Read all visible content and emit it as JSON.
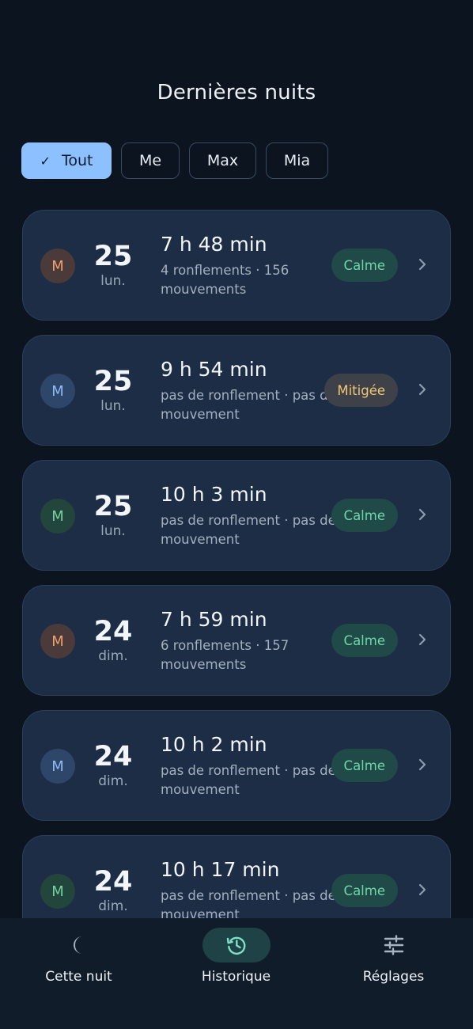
{
  "header": {
    "title": "Dernières nuits"
  },
  "filters": [
    {
      "label": "Tout",
      "active": true,
      "check": "✓",
      "width": 114
    },
    {
      "label": "Me",
      "active": false,
      "width": 74
    },
    {
      "label": "Max",
      "active": false,
      "width": 85
    },
    {
      "label": "Mia",
      "active": false,
      "width": 79
    }
  ],
  "nights": [
    {
      "initial": "M",
      "person": "me",
      "day": "25",
      "weekday": "lun.",
      "duration": "7 h 48 min",
      "details": "4 ronflements · 156 mouvements",
      "status": "Calme",
      "status_type": "calme"
    },
    {
      "initial": "M",
      "person": "max",
      "day": "25",
      "weekday": "lun.",
      "duration": "9 h 54 min",
      "details": "pas de ronflement · pas de mouvement",
      "status": "Mitigée",
      "status_type": "mitigee"
    },
    {
      "initial": "M",
      "person": "mia",
      "day": "25",
      "weekday": "lun.",
      "duration": "10 h 3 min",
      "details": "pas de ronflement · pas de mouvement",
      "status": "Calme",
      "status_type": "calme"
    },
    {
      "initial": "M",
      "person": "me",
      "day": "24",
      "weekday": "dim.",
      "duration": "7 h 59 min",
      "details": "6 ronflements · 157 mouvements",
      "status": "Calme",
      "status_type": "calme"
    },
    {
      "initial": "M",
      "person": "max",
      "day": "24",
      "weekday": "dim.",
      "duration": "10 h 2 min",
      "details": "pas de ronflement · pas de mouvement",
      "status": "Calme",
      "status_type": "calme"
    },
    {
      "initial": "M",
      "person": "mia",
      "day": "24",
      "weekday": "dim.",
      "duration": "10 h 17 min",
      "details": "pas de ronflement · pas de mouvement",
      "status": "Calme",
      "status_type": "calme"
    }
  ],
  "nav": {
    "items": [
      {
        "label": "Cette nuit",
        "icon": "moon-icon",
        "active": false
      },
      {
        "label": "Historique",
        "icon": "history-icon",
        "active": true
      },
      {
        "label": "Réglages",
        "icon": "sliders-icon",
        "active": false
      }
    ]
  },
  "colors": {
    "background": "#0c1420",
    "card": "#1c2d45",
    "accent": "#8cc0ff",
    "calme": "#6fd6a8",
    "mitigee": "#efc777"
  }
}
